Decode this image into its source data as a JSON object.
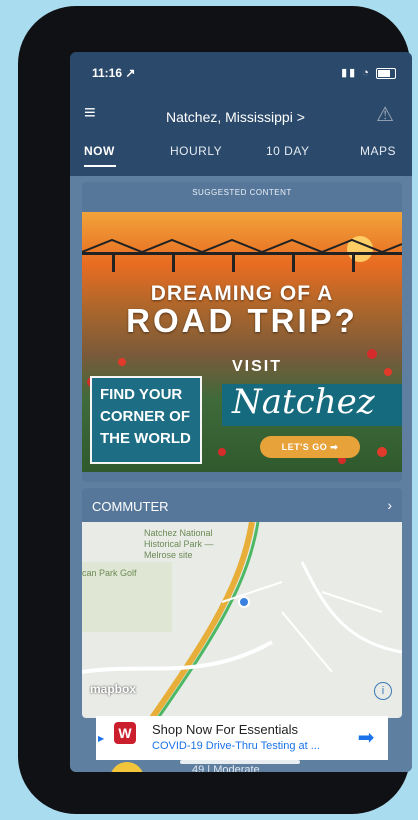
{
  "status": {
    "time": "11:16 ↗"
  },
  "header": {
    "location": "Natchez, Mississippi >"
  },
  "tabs": [
    {
      "label": "NOW"
    },
    {
      "label": "HOURLY"
    },
    {
      "label": "10 DAY"
    },
    {
      "label": "MAPS"
    }
  ],
  "suggested": {
    "label": "SUGGESTED CONTENT"
  },
  "ad": {
    "line1": "DREAMING OF A",
    "line2": "ROAD TRIP?",
    "find": "FIND YOUR CORNER OF THE WORLD",
    "visit": "VISIT",
    "brand": "Natchez",
    "cta": "LET'S GO ➡"
  },
  "commuter": {
    "title": "COMMUTER",
    "map_label_1": "Natchez National Historical Park — Melrose site",
    "map_label_2": "can Park Golf",
    "attribution": "mapbox"
  },
  "banner": {
    "title": "Shop Now For Essentials",
    "subtitle": "COVID-19 Drive-Thru Testing at ..."
  },
  "bottom": {
    "text": "49 | Moderate"
  },
  "colors": {
    "accent": "#2b4a6b",
    "brand_red": "#cc1f2e"
  }
}
